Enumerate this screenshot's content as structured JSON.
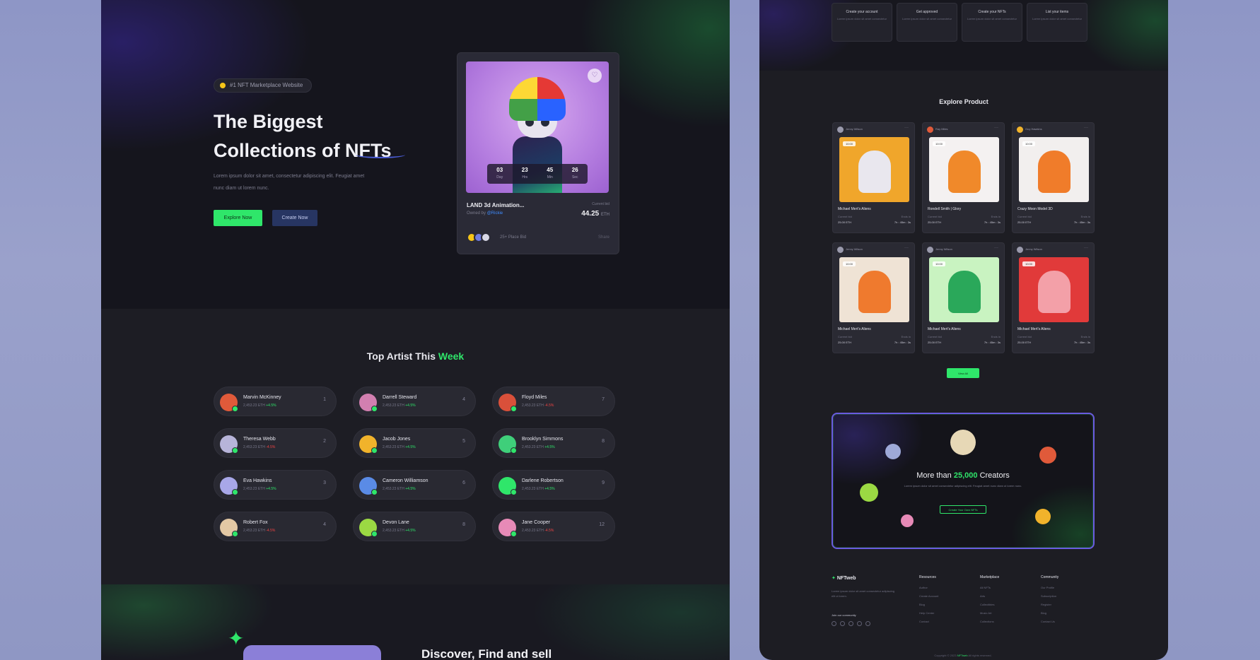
{
  "hero": {
    "badge": "#1 NFT Marketplace Website",
    "title_line1": "The Biggest",
    "title_line2": "Collections of NFTs",
    "description": "Lorem ipsum dolor sit amet, consectetur adipiscing elit. Feugiat amet nunc diam ut lorem nunc.",
    "explore_label": "Explore Now",
    "create_label": "Create Now"
  },
  "featured": {
    "timer": [
      {
        "value": "03",
        "unit": "Day"
      },
      {
        "value": "23",
        "unit": "Hrs"
      },
      {
        "value": "45",
        "unit": "Min"
      },
      {
        "value": "26",
        "unit": "Sec"
      }
    ],
    "name": "LAND 3d Animation...",
    "by_prefix": "Owned by",
    "by_name": "@Rickie",
    "price_label": "Current bid",
    "price": "44.25",
    "price_unit": "ETH",
    "bid_text": "25+ Place Bid",
    "bid_right": "Share"
  },
  "artists": {
    "title_prefix": "Top Artist This",
    "title_highlight": "Week",
    "list": [
      {
        "name": "Marvin McKinney",
        "sales": "2,453.23 ETH",
        "change": "+4.5%",
        "trend": "up",
        "num": "1",
        "color": "#e05a3a"
      },
      {
        "name": "Darrell Steward",
        "sales": "2,453.23 ETH",
        "change": "+4.5%",
        "trend": "up",
        "num": "4",
        "color": "#d27fb0"
      },
      {
        "name": "Floyd Miles",
        "sales": "2,453.23 ETH",
        "change": "-4.5%",
        "trend": "down",
        "num": "7",
        "color": "#d9503a"
      },
      {
        "name": "Theresa Webb",
        "sales": "2,453.23 ETH",
        "change": "-4.5%",
        "trend": "down",
        "num": "2",
        "color": "#b7b4d9"
      },
      {
        "name": "Jacob Jones",
        "sales": "2,453.23 ETH",
        "change": "+4.5%",
        "trend": "up",
        "num": "5",
        "color": "#f1b32b"
      },
      {
        "name": "Brooklyn Simmons",
        "sales": "2,453.23 ETH",
        "change": "+4.5%",
        "trend": "up",
        "num": "8",
        "color": "#3fcf7a"
      },
      {
        "name": "Eva Hawkins",
        "sales": "2,453.23 ETH",
        "change": "+4.5%",
        "trend": "up",
        "num": "3",
        "color": "#a8a7e8"
      },
      {
        "name": "Cameron Williamson",
        "sales": "2,453.23 ETH",
        "change": "+4.5%",
        "trend": "up",
        "num": "6",
        "color": "#5a8be6"
      },
      {
        "name": "Darlene Robertson",
        "sales": "2,453.23 ETH",
        "change": "+4.5%",
        "trend": "up",
        "num": "9",
        "color": "#2fe66a"
      },
      {
        "name": "Robert Fox",
        "sales": "2,453.23 ETH",
        "change": "-4.5%",
        "trend": "down",
        "num": "4",
        "color": "#e3c8a4"
      },
      {
        "name": "Devon Lane",
        "sales": "2,453.23 ETH",
        "change": "+4.5%",
        "trend": "up",
        "num": "8",
        "color": "#9bd943"
      },
      {
        "name": "Jane Cooper",
        "sales": "2,453.23 ETH",
        "change": "-4.5%",
        "trend": "down",
        "num": "12",
        "color": "#e78ab7"
      }
    ]
  },
  "discover": {
    "title": "Discover, Find and sell"
  },
  "steps": [
    {
      "title": "Create your account",
      "text": "Lorem ipsum dolor sit amet consectetur"
    },
    {
      "title": "Get approved",
      "text": "Lorem ipsum dolor sit amet consectetur"
    },
    {
      "title": "Create your NFTs",
      "text": "Lorem ipsum dolor sit amet consectetur"
    },
    {
      "title": "List your items",
      "text": "Lorem ipsum dolor sit amet consectetur"
    }
  ],
  "explore": {
    "title": "Explore Product",
    "view_all": "View All",
    "products": [
      {
        "owner": "Jenny Wilson",
        "name": "Michael Mert's Aliens",
        "bg": "#f0a62b",
        "shape": "#e9e7ee",
        "owner_color": "#9a9aac",
        "tag": "10:00"
      },
      {
        "owner": "Ray Miles",
        "name": "Rondell Smith | Glory",
        "bg": "#f4f1f1",
        "shape": "#f0892a",
        "owner_color": "#e05a3a",
        "tag": "10:00"
      },
      {
        "owner": "Guy Hawkins",
        "name": "Crazy Moon Model 3D",
        "bg": "#f2efee",
        "shape": "#f07c2a",
        "owner_color": "#f1b32b",
        "tag": "10:00"
      },
      {
        "owner": "Jenny Wilson",
        "name": "Michael Mert's Aliens",
        "bg": "#efe3d5",
        "shape": "#ef7a2e",
        "owner_color": "#9a9aac",
        "tag": "10:00"
      },
      {
        "owner": "Jenny Wilson",
        "name": "Michael Mert's Aliens",
        "bg": "#c9f3c1",
        "shape": "#2aa85a",
        "owner_color": "#9a9aac",
        "tag": "10:00"
      },
      {
        "owner": "Jenny Wilson",
        "name": "Michael Mert's Aliens",
        "bg": "#e13a3a",
        "shape": "#f3a0a8",
        "owner_color": "#9a9aac",
        "tag": "10:00"
      }
    ],
    "meta_left": "Current bid",
    "meta_right": "Ends in",
    "val_left": "25.00 ETH",
    "val_right": "7h : 45m : 3s"
  },
  "creators": {
    "title_prefix": "More than",
    "title_highlight": "25,000",
    "title_suffix": "Creators",
    "description": "Lorem ipsum dolor sit amet consectetur adipiscing elit. Feugiat amet nunc diam ut lorem nunc.",
    "button": "Create Your Own NFTs"
  },
  "footer": {
    "logo_mark": "✦",
    "logo": "NFTweb",
    "about": "Lorem ipsum dolor sit amet consectetur adipiscing elit ut lorem.",
    "join": "Join our community",
    "cols": [
      {
        "title": "Resources",
        "links": [
          "Author",
          "Create Account",
          "Blog",
          "Help Center",
          "Contact"
        ]
      },
      {
        "title": "Marketplace",
        "links": [
          "All NFTs",
          "Arts",
          "Collectibles",
          "Music Art",
          "Collections"
        ]
      },
      {
        "title": "Community",
        "links": [
          "Our Profile",
          "Subscription",
          "Register",
          "Blog",
          "Contact Us"
        ]
      }
    ],
    "copyright_prefix": "Copyright © 2023",
    "copyright_brand": "NFTweb",
    "copyright_suffix": "All rights reserved."
  }
}
